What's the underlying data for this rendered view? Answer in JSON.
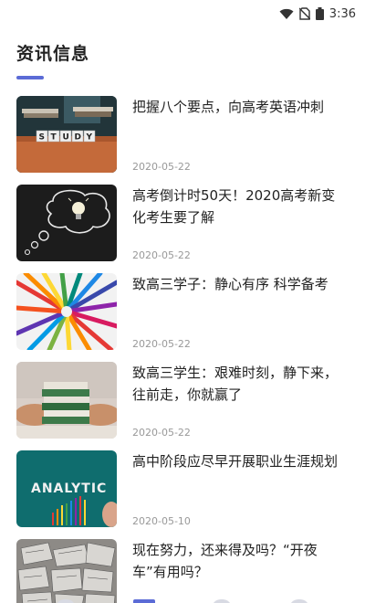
{
  "status_bar": {
    "time": "3:36",
    "icons": [
      "wifi-icon",
      "no-sim-icon",
      "battery-icon"
    ]
  },
  "header": {
    "title": "资讯信息"
  },
  "accent_color": "#5b6bd6",
  "articles": [
    {
      "title": "把握八个要点，向高考英语冲刺",
      "date": "2020-05-22",
      "image": "study-blocks"
    },
    {
      "title": "高考倒计时50天！2020高考新变化考生要了解",
      "date": "2020-05-22",
      "image": "lightbulb-chalkboard"
    },
    {
      "title": "致高三学子：静心有序 科学备考",
      "date": "2020-05-22",
      "image": "colored-pencils"
    },
    {
      "title": "致高三学生：艰难时刻，静下来，往前走，你就赢了",
      "date": "2020-05-22",
      "image": "book-stack"
    },
    {
      "title": "高中阶段应尽早开展职业生涯规划",
      "date": "2020-05-10",
      "image": "analytics-chalkboard"
    },
    {
      "title": "现在努力，还来得及吗？“开夜车”有用吗？",
      "date": "",
      "image": "paper-pile"
    }
  ],
  "tabbar": {
    "tabs": [
      "tab-1",
      "tab-2",
      "tab-3",
      "tab-4"
    ],
    "active_index": 1
  }
}
